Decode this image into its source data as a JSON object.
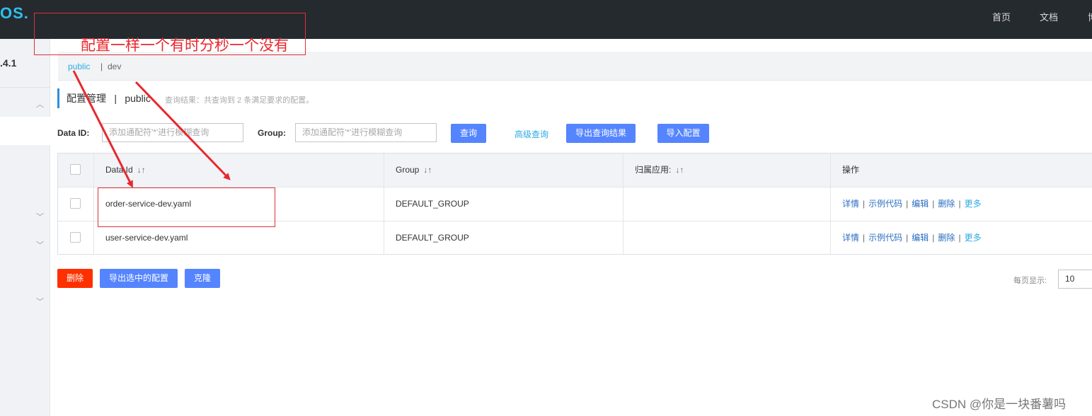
{
  "header": {
    "logo": "OS.",
    "nav": [
      "首页",
      "文档",
      "博"
    ]
  },
  "sidebar": {
    "version": ".4.1"
  },
  "namespace_bar": {
    "active": "public",
    "separator": "|",
    "other": "dev"
  },
  "page": {
    "title": "配置管理",
    "title_separator": "|",
    "namespace": "public",
    "query_result": "查询结果：共查询到 2 条满足要求的配置。"
  },
  "search": {
    "data_id_label": "Data ID:",
    "data_id_placeholder": "添加通配符'*'进行模糊查询",
    "group_label": "Group:",
    "group_placeholder": "添加通配符'*'进行模糊查询",
    "query_button": "查询",
    "advanced_link": "高级查询",
    "export_button": "导出查询结果",
    "import_button": "导入配置"
  },
  "table": {
    "columns": [
      "Data Id",
      "Group",
      "归属应用:",
      "操作"
    ],
    "sort_glyph": "↓↑",
    "rows": [
      {
        "data_id": "order-service-dev.yaml",
        "group": "DEFAULT_GROUP",
        "app": ""
      },
      {
        "data_id": "user-service-dev.yaml",
        "group": "DEFAULT_GROUP",
        "app": ""
      }
    ],
    "actions": [
      "详情",
      "示例代码",
      "编辑",
      "删除",
      "更多"
    ],
    "action_separator": "|"
  },
  "footer": {
    "delete_button": "删除",
    "export_selected_button": "导出选中的配置",
    "clone_button": "克隆",
    "page_size_label": "每页显示:",
    "page_size_value": "10"
  },
  "annotation": {
    "text": "配置一样一个有时分秒一个没有",
    "color": "#e8282e"
  },
  "watermark": "CSDN @你是一块番薯吗",
  "colors": {
    "topbar": "#252a2f",
    "primary": "#5584ff",
    "danger": "#ff3000",
    "link": "#2cabe3"
  }
}
